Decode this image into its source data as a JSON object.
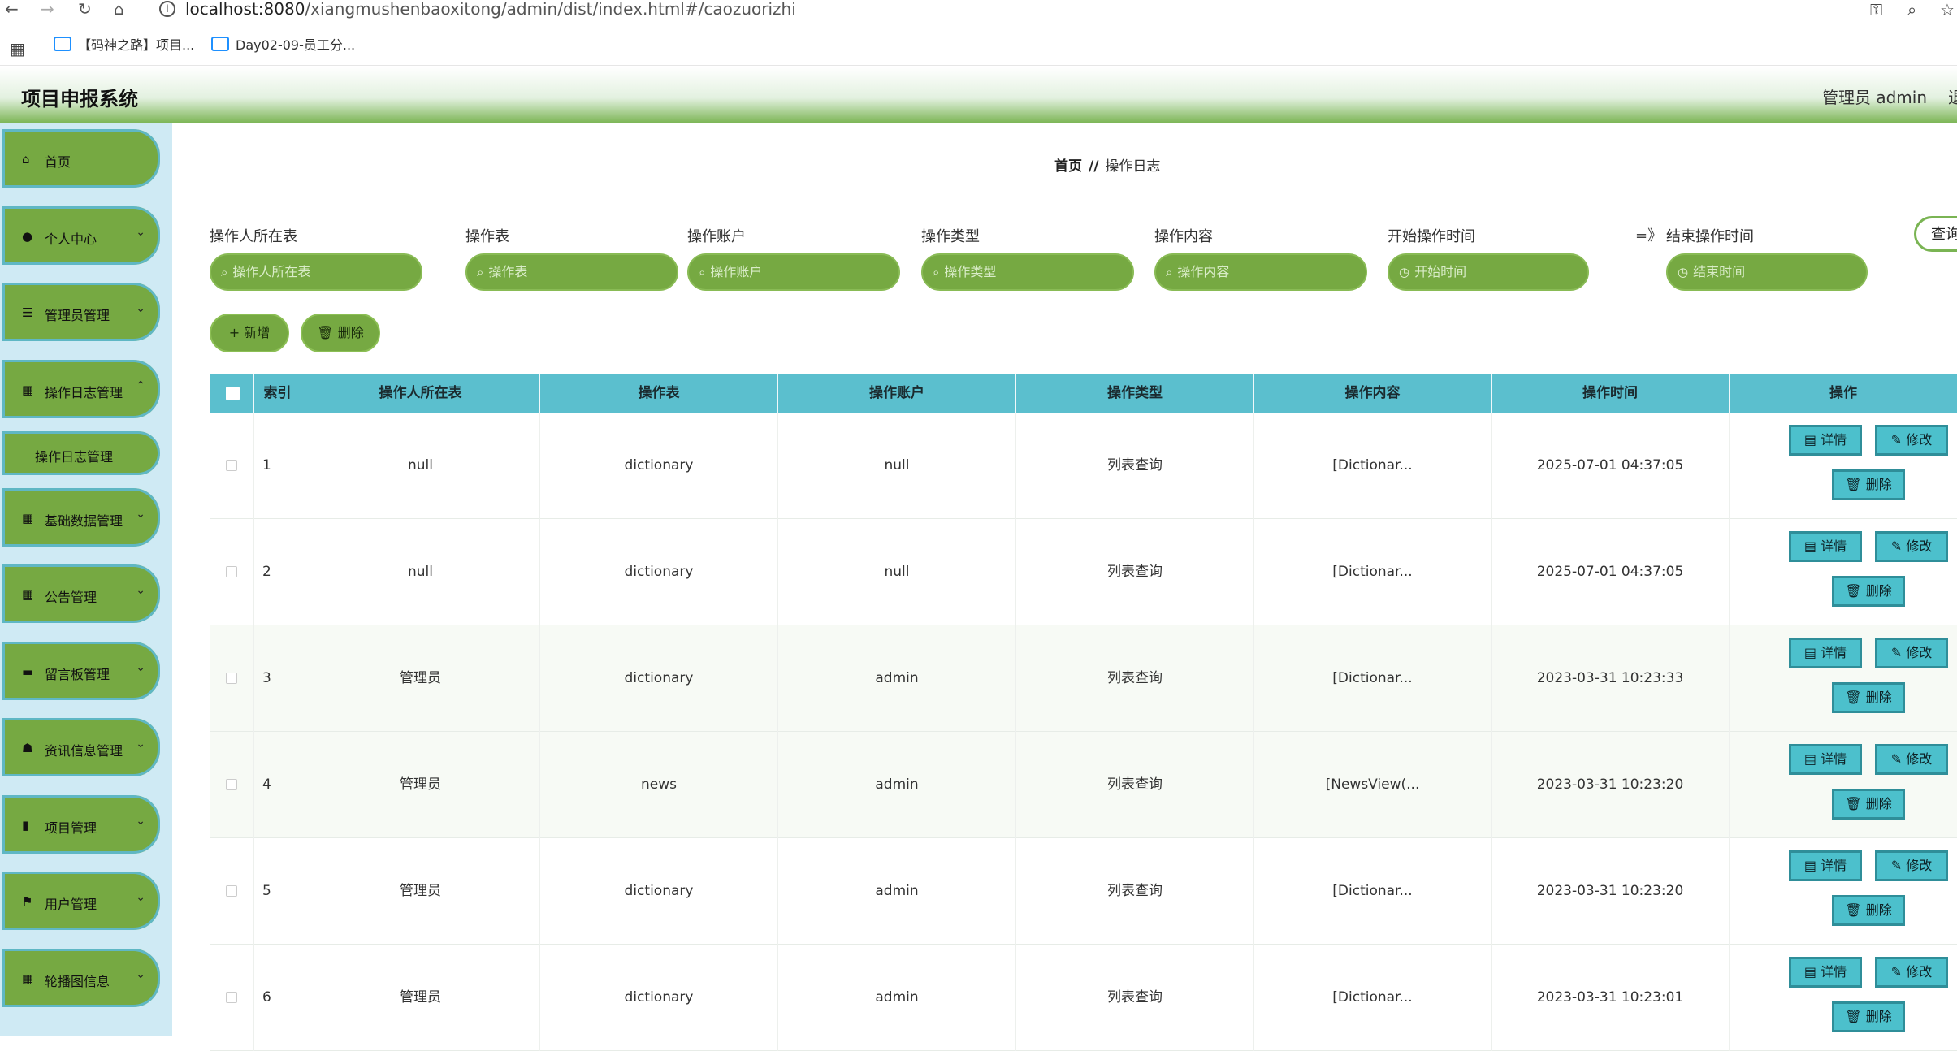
{
  "browser": {
    "url_host": "localhost:8080",
    "url_path": "/xiangmushenbaoxitong/admin/dist/index.html#/caozuorizhi",
    "bookmarks": [
      "【码神之路】项目...",
      "Day02-09-员工分..."
    ]
  },
  "header": {
    "title": "项目申报系统",
    "user": "管理员 admin",
    "logout": "退"
  },
  "sidebar": {
    "items": [
      {
        "label": "首页",
        "icon": "home-icon",
        "glyph": "⌂"
      },
      {
        "label": "个人中心",
        "icon": "user-icon",
        "glyph": "●"
      },
      {
        "label": "管理员管理",
        "icon": "list-icon",
        "glyph": "☰"
      },
      {
        "label": "操作日志管理",
        "icon": "grid-icon",
        "glyph": "▦"
      },
      {
        "label": "基础数据管理",
        "icon": "grid-icon",
        "glyph": "▦"
      },
      {
        "label": "公告管理",
        "icon": "grid-icon",
        "glyph": "▦"
      },
      {
        "label": "留言板管理",
        "icon": "ticket-icon",
        "glyph": "▬"
      },
      {
        "label": "资讯信息管理",
        "icon": "thumb-icon",
        "glyph": "☗"
      },
      {
        "label": "项目管理",
        "icon": "chart-icon",
        "glyph": "▮"
      },
      {
        "label": "用户管理",
        "icon": "flag-icon",
        "glyph": "⚑"
      },
      {
        "label": "轮播图信息",
        "icon": "grid-icon",
        "glyph": "▦"
      }
    ],
    "submenu_label": "操作日志管理"
  },
  "breadcrumb": {
    "home": "首页",
    "sep": "//",
    "current": "操作日志"
  },
  "filters": {
    "labels": [
      "操作人所在表",
      "操作表",
      "操作账户",
      "操作类型",
      "操作内容",
      "开始操作时间",
      "结束操作时间"
    ],
    "placeholders": [
      "操作人所在表",
      "操作表",
      "操作账户",
      "操作类型",
      "操作内容",
      "开始时间",
      "结束时间"
    ],
    "range_sep": "=》",
    "query": "查询"
  },
  "actions": {
    "add": "+ 新增",
    "delete": "🗑 删除"
  },
  "table": {
    "headers": [
      "索引",
      "操作人所在表",
      "操作表",
      "操作账户",
      "操作类型",
      "操作内容",
      "操作时间",
      "操作"
    ],
    "rows": [
      {
        "idx": "1",
        "owner_table": "null",
        "table": "dictionary",
        "account": "null",
        "type": "列表查询",
        "content": "[Dictionar...",
        "time": "2025-07-01 04:37:05"
      },
      {
        "idx": "2",
        "owner_table": "null",
        "table": "dictionary",
        "account": "null",
        "type": "列表查询",
        "content": "[Dictionar...",
        "time": "2025-07-01 04:37:05"
      },
      {
        "idx": "3",
        "owner_table": "管理员",
        "table": "dictionary",
        "account": "admin",
        "type": "列表查询",
        "content": "[Dictionar...",
        "time": "2023-03-31 10:23:33"
      },
      {
        "idx": "4",
        "owner_table": "管理员",
        "table": "news",
        "account": "admin",
        "type": "列表查询",
        "content": "[NewsView(...",
        "time": "2023-03-31 10:23:20"
      },
      {
        "idx": "5",
        "owner_table": "管理员",
        "table": "dictionary",
        "account": "admin",
        "type": "列表查询",
        "content": "[Dictionar...",
        "time": "2023-03-31 10:23:20"
      },
      {
        "idx": "6",
        "owner_table": "管理员",
        "table": "dictionary",
        "account": "admin",
        "type": "列表查询",
        "content": "[Dictionar...",
        "time": "2023-03-31 10:23:01"
      }
    ],
    "op_labels": {
      "detail": "详情",
      "edit": "修改",
      "delete": "删除"
    }
  }
}
